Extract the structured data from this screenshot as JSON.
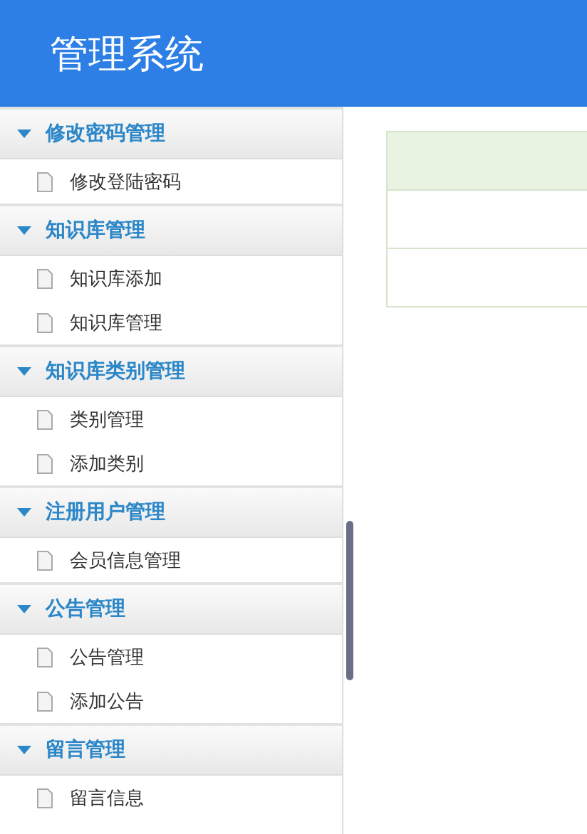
{
  "header": {
    "title": "管理系统"
  },
  "sidebar": {
    "groups": [
      {
        "title": "修改密码管理",
        "expanded": true,
        "items": [
          {
            "label": "修改登陆密码"
          }
        ]
      },
      {
        "title": "知识库管理",
        "expanded": true,
        "items": [
          {
            "label": "知识库添加"
          },
          {
            "label": "知识库管理"
          }
        ]
      },
      {
        "title": "知识库类别管理",
        "expanded": true,
        "items": [
          {
            "label": "类别管理"
          },
          {
            "label": "添加类别"
          }
        ]
      },
      {
        "title": "注册用户管理",
        "expanded": true,
        "items": [
          {
            "label": "会员信息管理"
          }
        ]
      },
      {
        "title": "公告管理",
        "expanded": true,
        "items": [
          {
            "label": "公告管理"
          },
          {
            "label": "添加公告"
          }
        ]
      },
      {
        "title": "留言管理",
        "expanded": true,
        "items": [
          {
            "label": "留言信息"
          }
        ]
      }
    ]
  }
}
